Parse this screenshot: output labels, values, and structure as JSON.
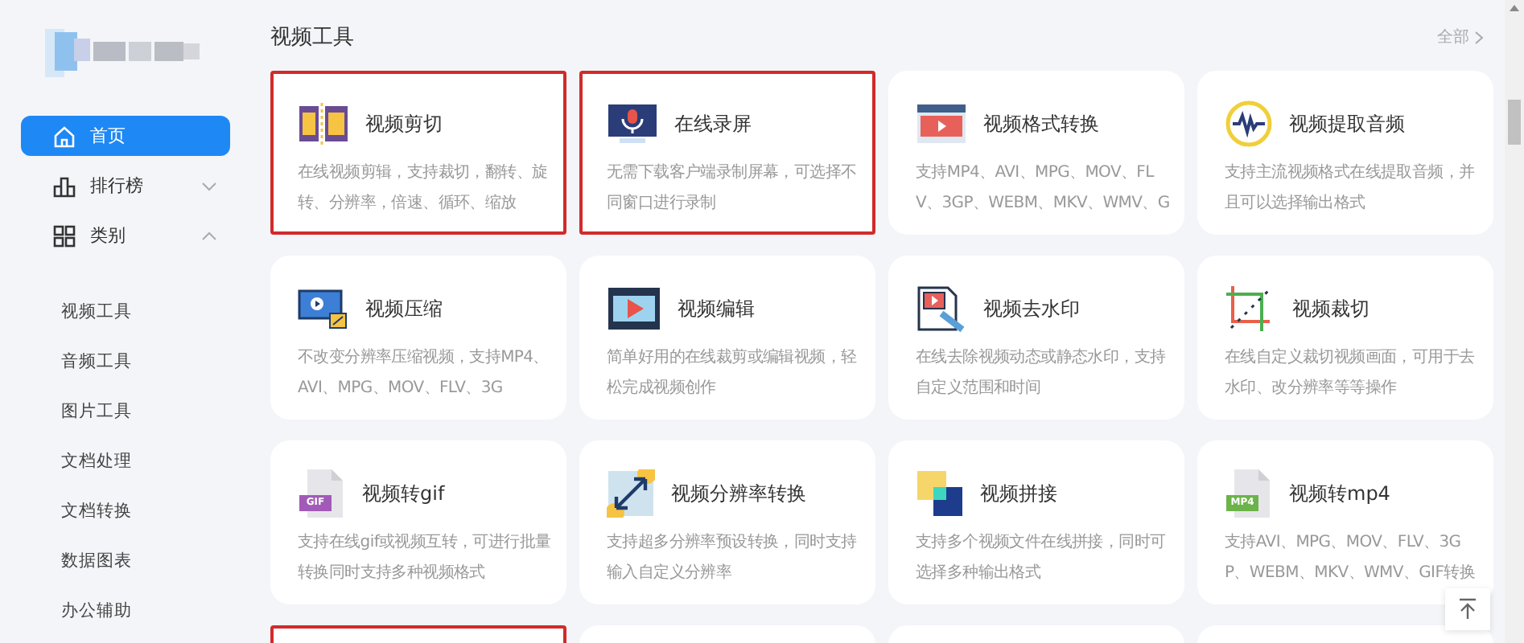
{
  "sidebar": {
    "items": [
      {
        "label": "首页",
        "kind": "home",
        "selected": true
      },
      {
        "label": "排行榜",
        "kind": "ranking",
        "selected": false,
        "expanded": false
      },
      {
        "label": "类别",
        "kind": "category",
        "selected": false,
        "expanded": true,
        "children": [
          {
            "label": "视频工具",
            "selected": false
          },
          {
            "label": "音频工具",
            "selected": false
          },
          {
            "label": "图片工具",
            "selected": false
          },
          {
            "label": "文档处理",
            "selected": false
          },
          {
            "label": "文档转换",
            "selected": false
          },
          {
            "label": "数据图表",
            "selected": false
          },
          {
            "label": "办公辅助",
            "selected": false
          }
        ]
      }
    ]
  },
  "section": {
    "title": "视频工具",
    "more": "全部"
  },
  "cards": [
    {
      "title": "视频剪切",
      "description": "在线视频剪辑，支持裁切，翻转、旋转、分辨率，倍速、循环、缩放",
      "highlighted": true
    },
    {
      "title": "在线录屏",
      "description": "无需下载客户端录制屏幕，可选择不同窗口进行录制",
      "highlighted": true
    },
    {
      "title": "视频格式转换",
      "description": "支持MP4、AVI、MPG、MOV、FLV、3GP、WEBM、MKV、WMV、G",
      "highlighted": false
    },
    {
      "title": "视频提取音频",
      "description": "支持主流视频格式在线提取音频，并且可以选择输出格式",
      "highlighted": false
    },
    {
      "title": "视频压缩",
      "description": "不改变分辨率压缩视频，支持MP4、AVI、MPG、MOV、FLV、3G",
      "highlighted": false
    },
    {
      "title": "视频编辑",
      "description": "简单好用的在线裁剪或编辑视频，轻松完成视频创作",
      "highlighted": false
    },
    {
      "title": "视频去水印",
      "description": "在线去除视频动态或静态水印，支持自定义范围和时间",
      "highlighted": false
    },
    {
      "title": "视频裁切",
      "description": "在线自定义裁切视频画面，可用于去水印、改分辨率等等操作",
      "highlighted": false
    },
    {
      "title": "视频转gif",
      "description": "支持在线gif或视频互转，可进行批量转换同时支持多种视频格式",
      "highlighted": false,
      "badge": "GIF"
    },
    {
      "title": "视频分辨率转换",
      "description": "支持超多分辨率预设转换，同时支持输入自定义分辨率",
      "highlighted": false
    },
    {
      "title": "视频拼接",
      "description": "支持多个视频文件在线拼接，同时可选择多种输出格式",
      "highlighted": false
    },
    {
      "title": "视频转mp4",
      "description": "支持AVI、MPG、MOV、FLV、3GP、WEBM、MKV、WMV、GIF转换",
      "highlighted": false,
      "badge": "MP4"
    }
  ],
  "partial_cards": [
    {
      "highlighted": true
    },
    {
      "highlighted": false
    },
    {
      "highlighted": false
    },
    {
      "highlighted": false
    }
  ]
}
